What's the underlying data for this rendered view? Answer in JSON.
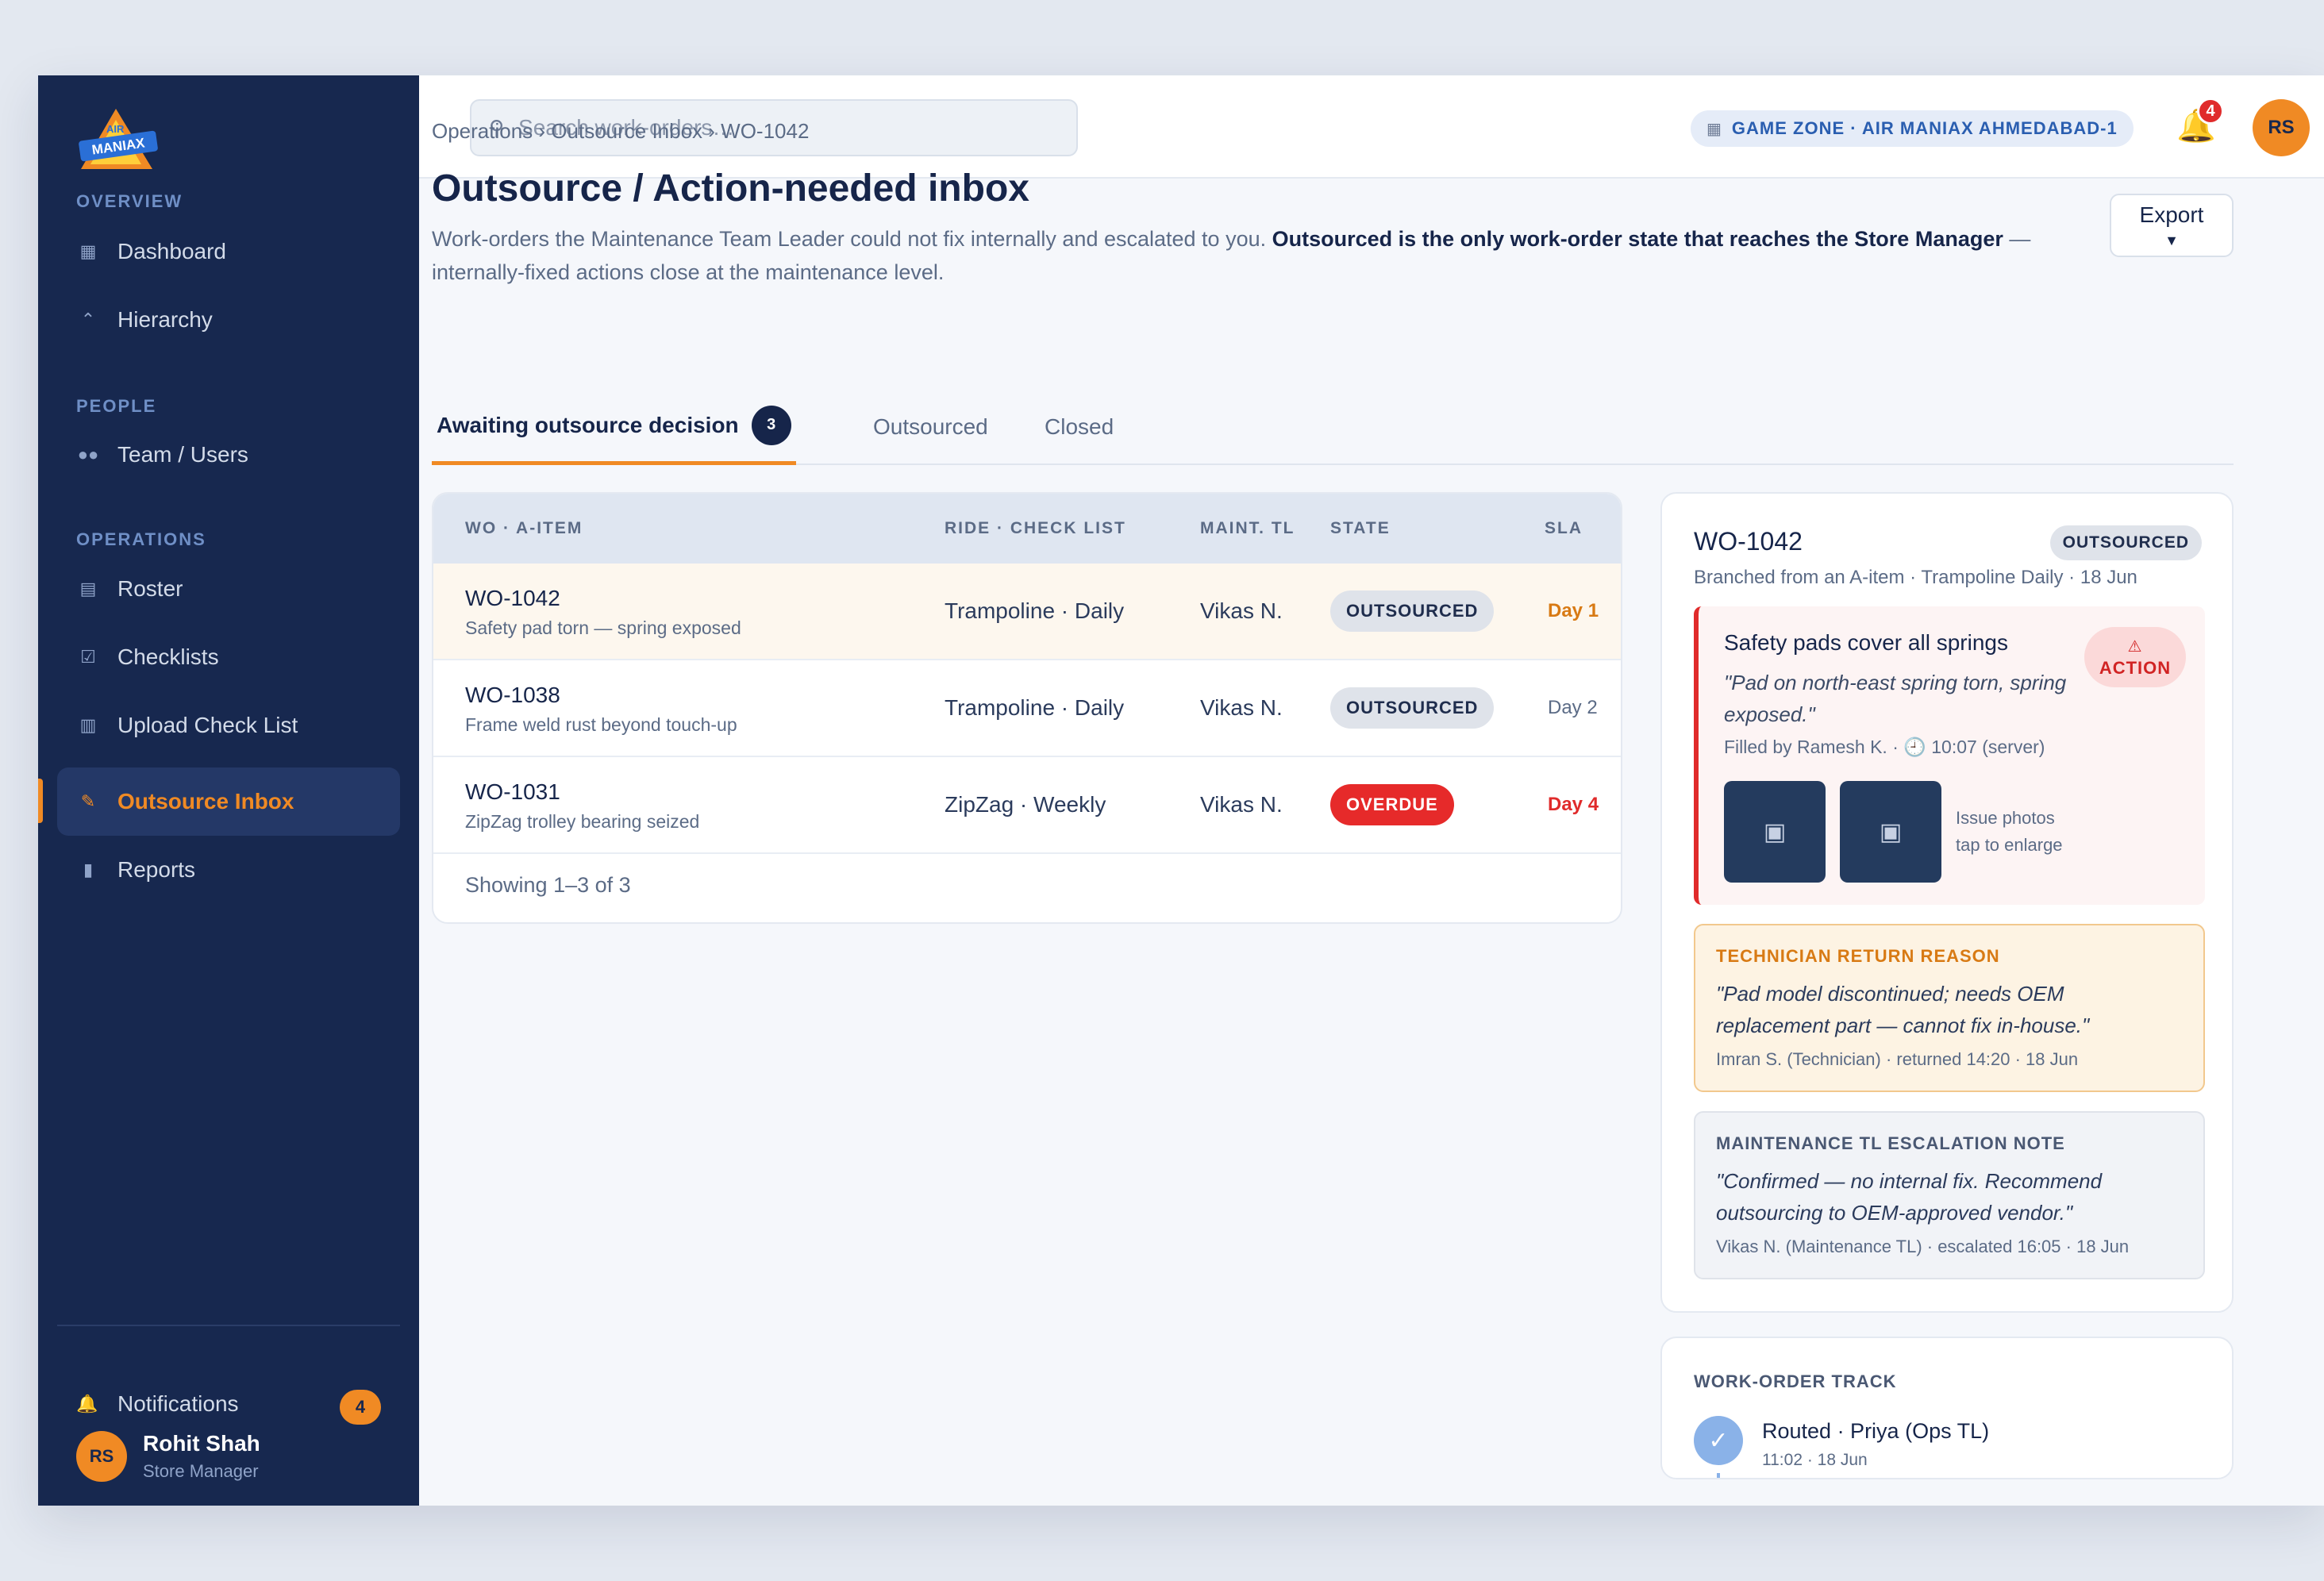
{
  "sidebar": {
    "sections": {
      "overview": "OVERVIEW",
      "people": "PEOPLE",
      "operations": "OPERATIONS"
    },
    "items": [
      {
        "label": "Dashboard",
        "icon": "dashboard-icon"
      },
      {
        "label": "Hierarchy",
        "icon": "hierarchy-icon"
      },
      {
        "label": "Team / Users",
        "icon": "users-icon"
      },
      {
        "label": "Roster",
        "icon": "calendar-icon"
      },
      {
        "label": "Checklists",
        "icon": "checklist-icon"
      },
      {
        "label": "Upload Check List",
        "icon": "clipboard-icon"
      },
      {
        "label": "Outsource Inbox",
        "icon": "wrench-icon",
        "active": true
      },
      {
        "label": "Reports",
        "icon": "bar-chart-icon"
      }
    ],
    "notifications": {
      "label": "Notifications",
      "count": "4"
    },
    "user": {
      "initials": "RS",
      "name": "Rohit Shah",
      "role": "Store Manager"
    }
  },
  "topbar": {
    "search_placeholder": "Search work-orders…",
    "zone": "GAME ZONE · AIR MANIAX AHMEDABAD-1",
    "bell_count": "4",
    "avatar_initials": "RS"
  },
  "page": {
    "breadcrumb": "Operations › Outsource Inbox › WO-1042",
    "title": "Outsource / Action-needed inbox",
    "desc_plain": "Work-orders the Maintenance Team Leader could not fix internally and escalated to you.",
    "desc_bold": "Outsourced is the only work-order state that reaches the Store Manager",
    "desc_tail": "— internally-fixed actions close at the maintenance level.",
    "export_label": "Export"
  },
  "tabs": [
    {
      "label": "Awaiting outsource decision",
      "count": "3",
      "active": true
    },
    {
      "label": "Outsourced"
    },
    {
      "label": "Closed"
    }
  ],
  "table": {
    "headers": [
      "WO · A-ITEM",
      "RIDE · CHECK LIST",
      "MAINT. TL",
      "STATE",
      "SLA"
    ],
    "rows": [
      {
        "id": "WO-1042",
        "desc": "Safety pad torn — spring exposed",
        "ride": "Trampoline · Daily",
        "tl": "Vikas N.",
        "state": "OUTSOURCED",
        "sla": "Day 1",
        "sla_color": "#d87a14",
        "state_style": "gray"
      },
      {
        "id": "WO-1038",
        "desc": "Frame weld rust beyond touch-up",
        "ride": "Trampoline · Daily",
        "tl": "Vikas N.",
        "state": "OUTSOURCED",
        "sla": "Day 2",
        "sla_color": "#5b6b86",
        "state_style": "gray"
      },
      {
        "id": "WO-1031",
        "desc": "ZipZag trolley bearing seized",
        "ride": "ZipZag · Weekly",
        "tl": "Vikas N.",
        "state": "OVERDUE",
        "sla": "Day 4",
        "sla_color": "#e02b2b",
        "state_style": "red"
      }
    ],
    "footer": "Showing 1–3 of 3"
  },
  "detail": {
    "title": "WO-1042",
    "badge": "OUTSOURCED",
    "subtitle": "Branched from an A-item · Trampoline Daily · 18 Jun",
    "action_box": {
      "title": "Safety pads cover all springs",
      "quote": "\"Pad on north-east spring torn, spring exposed.\"",
      "action_label": "ACTION",
      "meta": "Filled by Ramesh K. · 🕘 10:07 (server)",
      "hint_line1": "Issue photos",
      "hint_line2": "tap to enlarge"
    },
    "tech_note": {
      "heading": "TECHNICIAN RETURN REASON",
      "quote": "\"Pad model discontinued; needs OEM replacement part — cannot fix in-house.\"",
      "meta": "Imran S. (Technician) · returned 14:20 · 18 Jun"
    },
    "tl_note": {
      "heading": "MAINTENANCE TL ESCALATION NOTE",
      "quote": "\"Confirmed — no internal fix. Recommend outsourcing to OEM-approved vendor.\"",
      "meta": "Vikas N. (Maintenance TL) · escalated 16:05 · 18 Jun"
    }
  },
  "track": {
    "heading": "WORK-ORDER TRACK",
    "steps": [
      {
        "title": "Routed · Priya (Ops TL)",
        "time": "11:02 · 18 Jun"
      }
    ]
  },
  "colors": {
    "sidebar_bg": "#17284f",
    "accent": "#f08a24",
    "overdue": "#e62a2a"
  }
}
